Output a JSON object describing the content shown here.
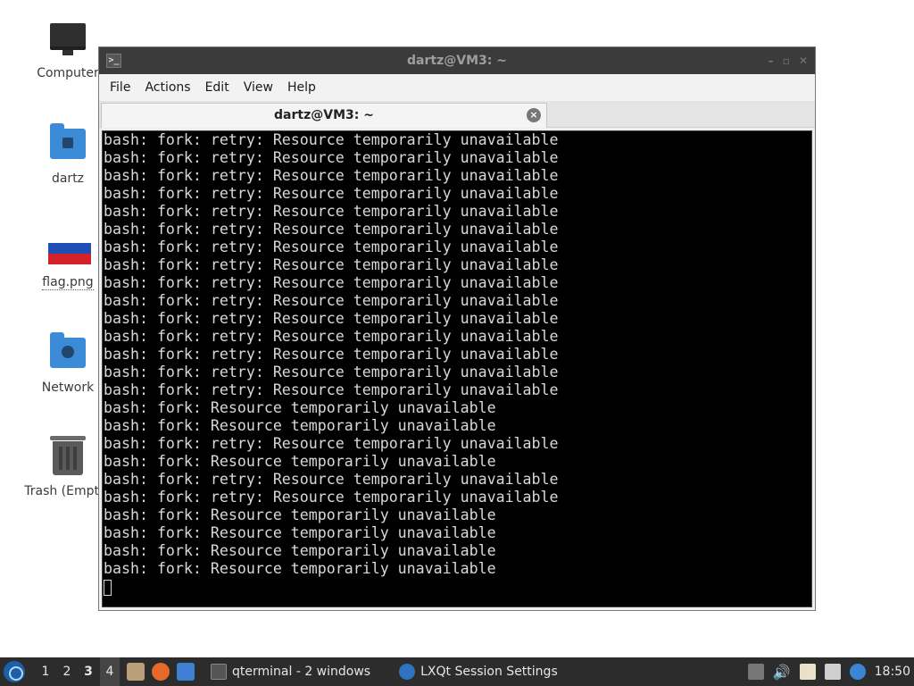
{
  "desktop": {
    "icons": [
      {
        "label": "Computer",
        "icon": "computer-icon"
      },
      {
        "label": "dartz",
        "icon": "home-folder-icon"
      },
      {
        "label": "flag.png",
        "icon": "image-file-icon"
      },
      {
        "label": "Network",
        "icon": "network-folder-icon"
      },
      {
        "label": "Trash (Empty)",
        "icon": "trash-icon"
      }
    ]
  },
  "window": {
    "title": "dartz@VM3: ~",
    "menu": [
      "File",
      "Actions",
      "Edit",
      "View",
      "Help"
    ],
    "tab_title": "dartz@VM3: ~",
    "terminal_lines": [
      "bash: fork: retry: Resource temporarily unavailable",
      "bash: fork: retry: Resource temporarily unavailable",
      "bash: fork: retry: Resource temporarily unavailable",
      "bash: fork: retry: Resource temporarily unavailable",
      "bash: fork: retry: Resource temporarily unavailable",
      "bash: fork: retry: Resource temporarily unavailable",
      "bash: fork: retry: Resource temporarily unavailable",
      "bash: fork: retry: Resource temporarily unavailable",
      "bash: fork: retry: Resource temporarily unavailable",
      "bash: fork: retry: Resource temporarily unavailable",
      "bash: fork: retry: Resource temporarily unavailable",
      "bash: fork: retry: Resource temporarily unavailable",
      "bash: fork: retry: Resource temporarily unavailable",
      "bash: fork: retry: Resource temporarily unavailable",
      "bash: fork: retry: Resource temporarily unavailable",
      "bash: fork: Resource temporarily unavailable",
      "bash: fork: Resource temporarily unavailable",
      "bash: fork: retry: Resource temporarily unavailable",
      "bash: fork: Resource temporarily unavailable",
      "bash: fork: retry: Resource temporarily unavailable",
      "bash: fork: retry: Resource temporarily unavailable",
      "bash: fork: Resource temporarily unavailable",
      "bash: fork: Resource temporarily unavailable",
      "bash: fork: Resource temporarily unavailable",
      "bash: fork: Resource temporarily unavailable"
    ]
  },
  "taskbar": {
    "desktops": [
      "1",
      "2",
      "3",
      "4"
    ],
    "current_desktop": "3",
    "tasks": [
      {
        "label": "qterminal - 2 windows",
        "icon": "terminal-icon"
      },
      {
        "label": "LXQt Session Settings",
        "icon": "session-settings-icon"
      }
    ],
    "clock": "18:50"
  },
  "colors": {
    "titlebar": "#3b3b3b",
    "terminal_bg": "#000000",
    "terminal_fg": "#d8d8d8",
    "taskbar": "#2c2c2c",
    "folder": "#3c8bd6"
  }
}
